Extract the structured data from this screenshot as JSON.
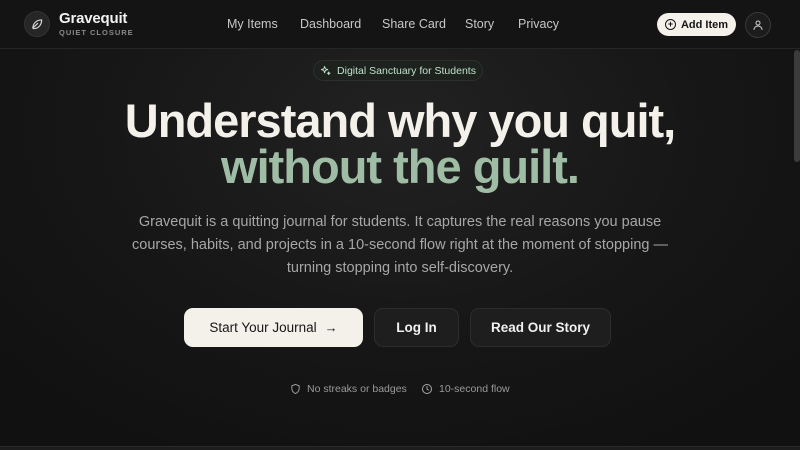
{
  "brand": {
    "name": "Gravequit",
    "tagline": "QUIET CLOSURE",
    "icon": "leaf-icon"
  },
  "nav": {
    "items": [
      {
        "label": "My Items"
      },
      {
        "label": "Dashboard"
      },
      {
        "label": "Share Card"
      },
      {
        "label": "Story"
      },
      {
        "label": "Privacy"
      }
    ],
    "add_item_label": "Add Item",
    "user_icon": "user-icon"
  },
  "hero": {
    "badge": "Digital Sanctuary for Students",
    "headline_line1": "Understand why you quit,",
    "headline_line2": "without the guilt.",
    "description": "Gravequit is a quitting journal for students. It captures the real reasons you pause courses, habits, and projects in a 10-second flow right at the moment of stopping — turning stopping into self-discovery.",
    "cta_primary": "Start Your Journal",
    "cta_login": "Log In",
    "cta_story": "Read Our Story",
    "features": [
      {
        "label": "No streaks or badges",
        "icon": "shield-icon"
      },
      {
        "label": "10-second flow",
        "icon": "clock-icon"
      }
    ]
  },
  "colors": {
    "background": "#121212",
    "accent_green": "#9fbca5",
    "cream": "#f3f1ea",
    "badge_text": "#bfe0c9"
  }
}
